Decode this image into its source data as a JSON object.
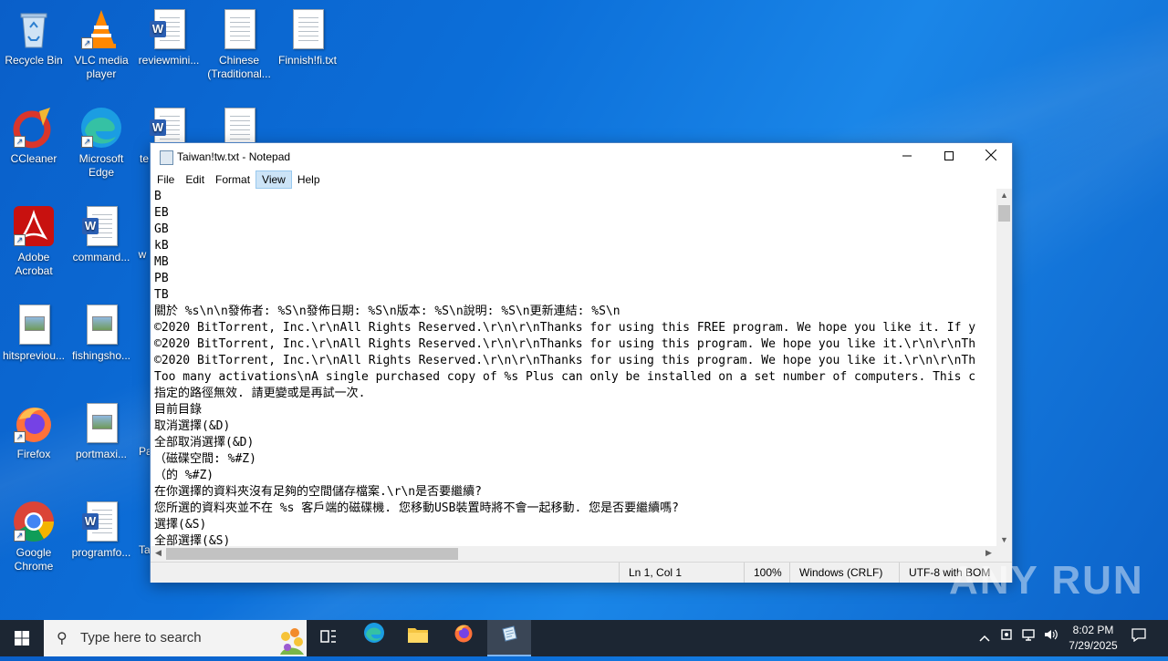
{
  "desktop": {
    "icons": [
      {
        "label": "Recycle Bin"
      },
      {
        "label": "VLC media player"
      },
      {
        "label": "reviewmini..."
      },
      {
        "label": "Chinese (Traditional..."
      },
      {
        "label": "Finnish!fi.txt"
      },
      {
        "label": "CCleaner"
      },
      {
        "label": "Microsoft Edge"
      },
      {
        "label": "te"
      },
      {
        "label": "Adobe Acrobat"
      },
      {
        "label": "command..."
      },
      {
        "label": "w"
      },
      {
        "label": "hitspreviou..."
      },
      {
        "label": "fishingsho..."
      },
      {
        "label": "Firefox"
      },
      {
        "label": "portmaxi..."
      },
      {
        "label": "Pa"
      },
      {
        "label": "Google Chrome"
      },
      {
        "label": "programfo..."
      },
      {
        "label": "Ta"
      }
    ]
  },
  "notepad": {
    "title": "Taiwan!tw.txt - Notepad",
    "menu": [
      "File",
      "Edit",
      "Format",
      "View",
      "Help"
    ],
    "active_menu": "View",
    "lines": [
      "B",
      "EB",
      "GB",
      "kB",
      "MB",
      "PB",
      "TB",
      "關於 %s\\n\\n發佈者: %S\\n發佈日期: %S\\n版本: %S\\n說明: %S\\n更新連結: %S\\n",
      "©2020 BitTorrent, Inc.\\r\\nAll Rights Reserved.\\r\\n\\r\\nThanks for using this FREE program. We hope you like it. If y",
      "©2020 BitTorrent, Inc.\\r\\nAll Rights Reserved.\\r\\n\\r\\nThanks for using this program. We hope you like it.\\r\\n\\r\\nTh",
      "©2020 BitTorrent, Inc.\\r\\nAll Rights Reserved.\\r\\n\\r\\nThanks for using this program. We hope you like it.\\r\\n\\r\\nTh",
      "Too many activations\\nA single purchased copy of %s Plus can only be installed on a set number of computers. This c",
      "指定的路徑無效. 請更變或是再試一次.",
      "目前目錄",
      "取消選擇(&D)",
      "全部取消選擇(&D)",
      "（磁碟空間: %#Z)",
      "（的 %#Z)",
      "在你選擇的資料夾沒有足夠的空間儲存檔案.\\r\\n是否要繼續?",
      "您所選的資料夾並不在 %s 客戶端的磁碟機. 您移動USB裝置時將不會一起移動. 您是否要繼續嗎?",
      "選擇(&S)",
      "全部選擇(&S)"
    ],
    "status": {
      "position": "Ln 1, Col 1",
      "zoom": "100%",
      "line_ending": "Windows (CRLF)",
      "encoding": "UTF-8 with BOM"
    }
  },
  "watermark": "ANY RUN",
  "taskbar": {
    "search_placeholder": "Type here to search",
    "time": "8:02 PM",
    "date": "7/29/2025"
  }
}
